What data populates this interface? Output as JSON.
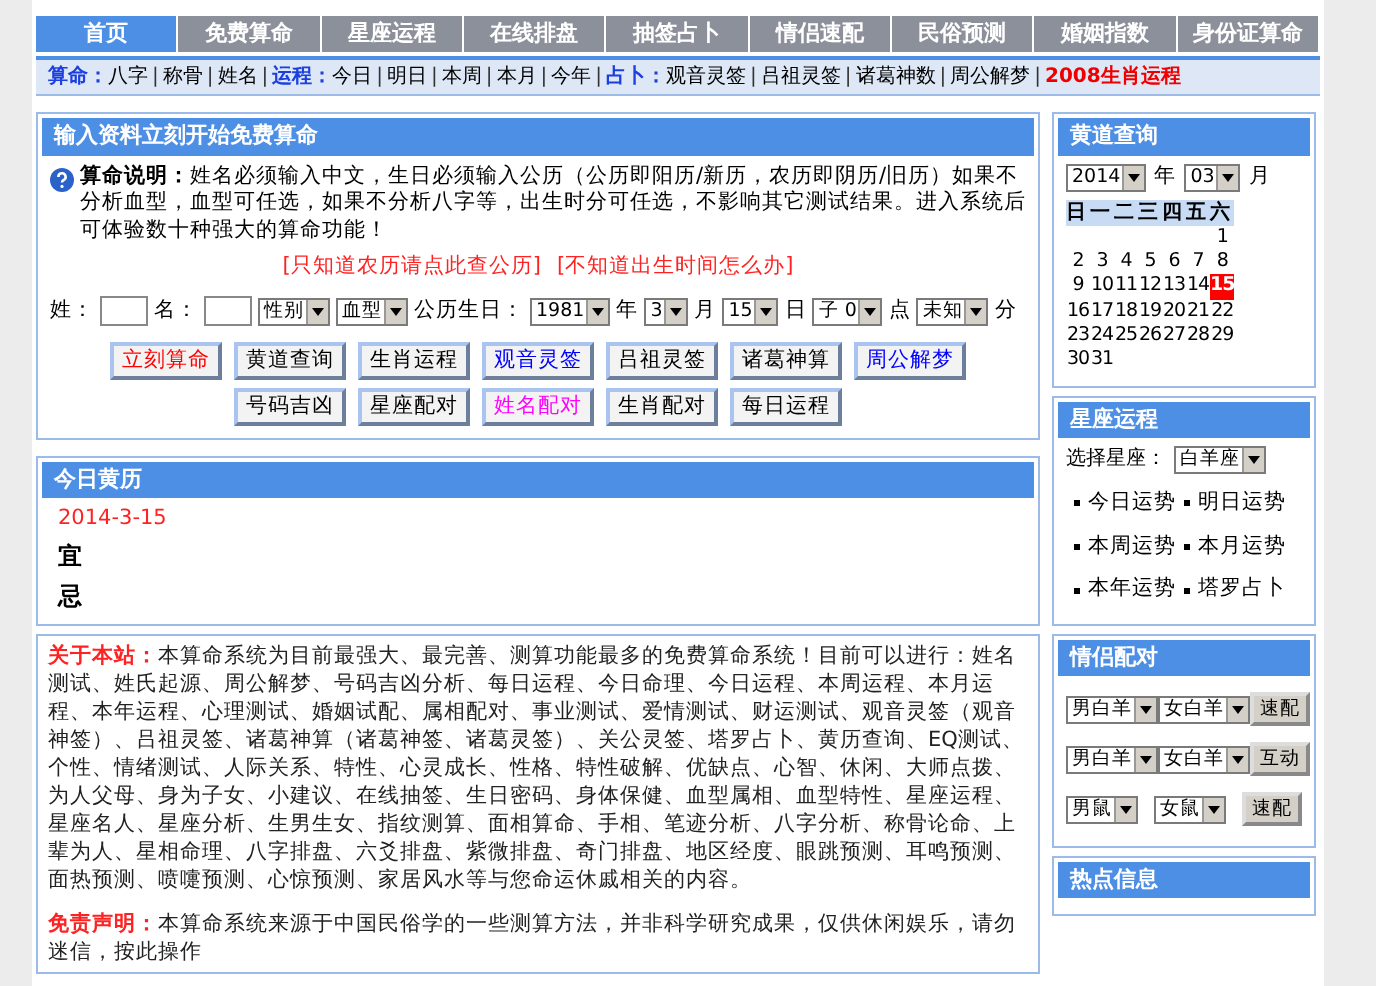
{
  "nav": {
    "tabs": [
      {
        "label": "首页",
        "selected": true
      },
      {
        "label": "免费算命",
        "selected": false
      },
      {
        "label": "星座运程",
        "selected": false
      },
      {
        "label": "在线排盘",
        "selected": false
      },
      {
        "label": "抽签占卜",
        "selected": false
      },
      {
        "label": "情侣速配",
        "selected": false
      },
      {
        "label": "民俗预测",
        "selected": false
      },
      {
        "label": "婚姻指数",
        "selected": false
      },
      {
        "label": "身份证算命",
        "selected": false
      }
    ]
  },
  "subnav": [
    {
      "kind": "category",
      "text": "算命："
    },
    {
      "kind": "link",
      "text": "八字"
    },
    {
      "kind": "separator",
      "text": "|"
    },
    {
      "kind": "link",
      "text": "称骨"
    },
    {
      "kind": "separator",
      "text": "|"
    },
    {
      "kind": "link",
      "text": "姓名"
    },
    {
      "kind": "separator",
      "text": "|"
    },
    {
      "kind": "category",
      "text": "运程："
    },
    {
      "kind": "link",
      "text": "今日"
    },
    {
      "kind": "separator",
      "text": "|"
    },
    {
      "kind": "link",
      "text": "明日"
    },
    {
      "kind": "separator",
      "text": "|"
    },
    {
      "kind": "link",
      "text": "本周"
    },
    {
      "kind": "separator",
      "text": "|"
    },
    {
      "kind": "link",
      "text": "本月"
    },
    {
      "kind": "separator",
      "text": "|"
    },
    {
      "kind": "link",
      "text": "今年"
    },
    {
      "kind": "separator",
      "text": "|"
    },
    {
      "kind": "category",
      "text": "占卜："
    },
    {
      "kind": "link",
      "text": "观音灵签"
    },
    {
      "kind": "separator",
      "text": "|"
    },
    {
      "kind": "link",
      "text": "吕祖灵签"
    },
    {
      "kind": "separator",
      "text": "|"
    },
    {
      "kind": "link",
      "text": "诸葛神数"
    },
    {
      "kind": "separator",
      "text": "|"
    },
    {
      "kind": "link",
      "text": "周公解梦"
    },
    {
      "kind": "separator",
      "text": "|"
    },
    {
      "kind": "highlight",
      "text": "2008生肖运程"
    }
  ],
  "form_panel": {
    "title": "输入资料立刻开始免费算命",
    "help_text": "**算命说明：**姓名必须输入中文，生日必须输入公历（公历即阳历/新历，农历即阴历/旧历）如果不分析血型，血型可任选，如果不分析八字等，出生时分可任选，不影响其它测试结果。进入系统后可体验数十种强大的算命功能！",
    "links": [
      "[只知道农历请点此查公历]",
      "[不知道出生时间怎么办]"
    ],
    "fields": [
      {
        "kind": "label",
        "text": "姓："
      },
      {
        "kind": "input"
      },
      {
        "kind": "label",
        "text": "名："
      },
      {
        "kind": "input"
      },
      {
        "kind": "select",
        "value": "性别"
      },
      {
        "kind": "select",
        "value": "血型"
      },
      {
        "kind": "label",
        "text": "公历生日："
      },
      {
        "kind": "select",
        "value": "1981"
      },
      {
        "kind": "label",
        "text": "年"
      },
      {
        "kind": "select",
        "value": "3"
      },
      {
        "kind": "label",
        "text": "月"
      },
      {
        "kind": "select",
        "value": "15"
      },
      {
        "kind": "label",
        "text": "日"
      },
      {
        "kind": "select",
        "value": "子 0"
      },
      {
        "kind": "label",
        "text": "点"
      },
      {
        "kind": "select",
        "value": "未知"
      },
      {
        "kind": "label",
        "text": "分"
      }
    ],
    "button_rows": [
      [
        {
          "label": "立刻算命",
          "color": "#ff0000"
        },
        {
          "label": "黄道查询",
          "color": "#000000"
        },
        {
          "label": "生肖运程",
          "color": "#000000"
        },
        {
          "label": "观音灵签",
          "color": "#0000ff"
        },
        {
          "label": "吕祖灵签",
          "color": "#000000"
        },
        {
          "label": "诸葛神算",
          "color": "#000000"
        },
        {
          "label": "周公解梦",
          "color": "#0000ff"
        }
      ],
      [
        {
          "label": "号码吉凶",
          "color": "#000000"
        },
        {
          "label": "星座配对",
          "color": "#000000"
        },
        {
          "label": "姓名配对",
          "color": "#ff00ff"
        },
        {
          "label": "生肖配对",
          "color": "#000000"
        },
        {
          "label": "每日运程",
          "color": "#000000"
        }
      ]
    ]
  },
  "today_panel": {
    "title": "今日黄历",
    "date": "2014-3-15",
    "good": "宜",
    "bad": "忌"
  },
  "about": {
    "text": "**关于本站：**本算命系统为目前最强大、最完善、测算功能最多的免费算命系统！目前可以进行：姓名测试、姓氏起源、周公解梦、号码吉凶分析、每日运程、今日命理、今日运程、本周运程、本月运程、本年运程、心理测试、婚姻试配、属相配对、事业测试、爱情测试、财运测试、观音灵签（观音神签）、吕祖灵签、诸葛神算（诸葛神签、诸葛灵签）、关公灵签、塔罗占卜、黄历查询、EQ测试、个性、情绪测试、人际关系、特性、心灵成长、性格、特性破解、优缺点、心智、休闲、大师点拨、为人父母、身为子女、小建议、在线抽签、生日密码、身体保健、血型属相、血型特性、星座运程、星座名人、星座分析、生男生女、指纹测算、面相算命、手相、笔迹分析、八字分析、称骨论命、上辈为人、星相命理、八字排盘、六爻排盘、紫微排盘、奇门排盘、地区经度、眼跳预测、耳鸣预测、面热预测、喷嚏预测、心惊预测、家居风水等与您命运休戚相关的内容。",
    "disclaimer_text": "**免责声明：**本算命系统来源于中国民俗学的一些测算方法，并非科学研究成果，仅供休闲娱乐，请勿迷信，按此操作"
  },
  "calendar": {
    "title": "黄道查询",
    "year": "2014",
    "year_unit": "年",
    "month": "03",
    "month_unit": "月",
    "weekdays": [
      "日",
      "一",
      "二",
      "三",
      "四",
      "五",
      "六"
    ],
    "days": [
      {
        "day": "1",
        "selected": false
      },
      {
        "day": "2",
        "selected": false
      },
      {
        "day": "3",
        "selected": false
      },
      {
        "day": "4",
        "selected": false
      },
      {
        "day": "5",
        "selected": false
      },
      {
        "day": "6",
        "selected": false
      },
      {
        "day": "7",
        "selected": false
      },
      {
        "day": "8",
        "selected": false
      },
      {
        "day": "9",
        "selected": false
      },
      {
        "day": "10",
        "selected": false
      },
      {
        "day": "11",
        "selected": false
      },
      {
        "day": "12",
        "selected": false
      },
      {
        "day": "13",
        "selected": false
      },
      {
        "day": "14",
        "selected": false
      },
      {
        "day": "15",
        "selected": true
      },
      {
        "day": "16",
        "selected": false
      },
      {
        "day": "17",
        "selected": false
      },
      {
        "day": "18",
        "selected": false
      },
      {
        "day": "19",
        "selected": false
      },
      {
        "day": "20",
        "selected": false
      },
      {
        "day": "21",
        "selected": false
      },
      {
        "day": "22",
        "selected": false
      },
      {
        "day": "23",
        "selected": false
      },
      {
        "day": "24",
        "selected": false
      },
      {
        "day": "25",
        "selected": false
      },
      {
        "day": "26",
        "selected": false
      },
      {
        "day": "27",
        "selected": false
      },
      {
        "day": "28",
        "selected": false
      },
      {
        "day": "29",
        "selected": false
      },
      {
        "day": "30",
        "selected": false
      },
      {
        "day": "31",
        "selected": false
      }
    ]
  },
  "horoscope": {
    "title": "星座运程",
    "select_label": "选择星座：",
    "sign": "白羊座",
    "links": [
      "今日运势",
      "明日运势",
      "本周运势",
      "本月运势",
      "本年运势",
      "塔罗占卜"
    ]
  },
  "match": {
    "title": "情侣配对",
    "rows": [
      {
        "male": "男白羊",
        "female": "女白羊",
        "button": "速配"
      },
      {
        "male": "男白羊",
        "female": "女白羊",
        "button": "互动"
      },
      {
        "male": "男鼠",
        "female": "女鼠",
        "button": "速配"
      }
    ]
  },
  "hot": {
    "title": "热点信息"
  }
}
